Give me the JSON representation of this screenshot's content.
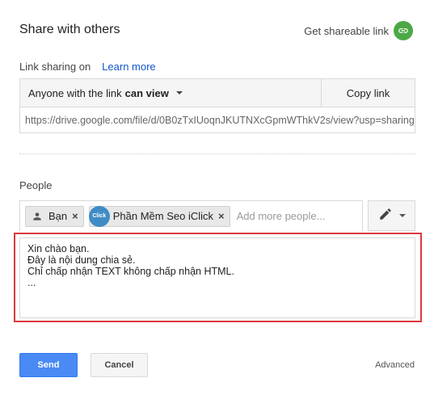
{
  "dialog": {
    "title": "Share with others",
    "get_shareable_link": "Get shareable link",
    "link_icon": "link-icon"
  },
  "link_sharing": {
    "label": "Link sharing on",
    "learn_more": "Learn more",
    "access_prefix": "Anyone with the link",
    "access_level": "can view",
    "copy_link": "Copy link",
    "url": "https://drive.google.com/file/d/0B0zTxIUoqnJKUTNXcGpmWThkV2s/view?usp=sharing"
  },
  "people": {
    "label": "People",
    "chips": [
      {
        "name": "Bạn",
        "icon": "person-icon"
      },
      {
        "name": "Phần Mềm Seo iClick",
        "avatar_text": "Click"
      }
    ],
    "placeholder": "Add more people...",
    "permission_icon": "pencil-icon"
  },
  "message": {
    "lines": [
      "Xin chào bạn.",
      "Đây là nội dung chia sẻ.",
      "Chỉ chấp nhận TEXT không chấp nhận HTML.",
      "..."
    ]
  },
  "footer": {
    "send": "Send",
    "cancel": "Cancel",
    "advanced": "Advanced"
  },
  "colors": {
    "send_button": "#4a8af4",
    "link_icon_bg": "#4ca847",
    "highlight_border": "#d9393e",
    "learn_more_link": "#1155cc"
  }
}
